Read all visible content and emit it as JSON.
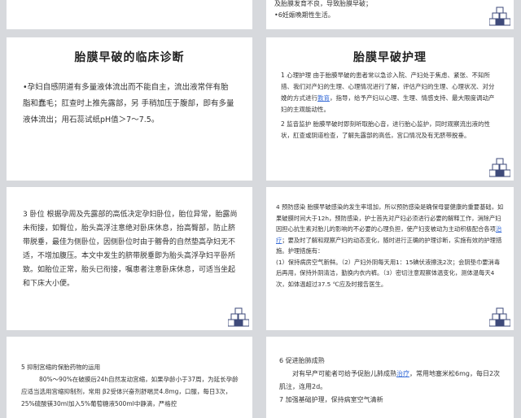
{
  "slides": {
    "s1": {
      "lines": [
        "及胎膜发育不良，导致胎膜早破；",
        "•6妊娠晚期性生活。"
      ]
    },
    "s2": {
      "title": "胎膜早破的临床诊断",
      "body": "•孕妇自感阴道有多量液体流出而不能自主，流出液常伴有胎脂和蠢毛；肛查时上推先露部，另 手稍加压于腹部，即有多量液体流出；用石蕊试纸pH值＞7～7.5。"
    },
    "s3": {
      "title": "胎膜早破护理",
      "p1": "1 心理护理 由于胎膜早破的患者常以急诊入院、产妇处于焦虑、紧张、不知所措、我们对产妇的生理、心理情况进行了解，评估产妇的生理、心理状况、对分娩的方式进行",
      "p1_link": "教育",
      "p1_rest": "，指导，给予产妇以心理、生理、情感支持、最大限度调动产妇的主观能动性。",
      "p2": "2 监音监护 胎膜早破时即刻听取胎心音，进行胎心监护，同时观察流出液的性状，肛查或阴道检查，了解先露部的高低，宫口情况及有无脐带脱垂。"
    },
    "s4": {
      "body": "3 卧位 根据孕周及先露部的高低决定孕妇卧位，胎位异常，胎露尚未衔接，如臀位，胎头高浮注意绝对卧床休息，抬高臀部，防止脐带脱垂，最佳为侧卧位，因侧卧位时由于髂骨的自然垫高孕妇无不适，不增加腹压。本文中发生的脐带脱垂即为胎头高浮孕妇平卧所致。如胎位正常，胎头已衔接，嘱患者注意卧床休息，可适当坐起和下床大小便。"
    },
    "s5": {
      "p1": "4 预防感染 胎膜早破感染的发生率增加，所以预防感染是确保母婴健康的重要基础，如果破膜时间大于12h，预防感染，护士首先对产妇必须进行必要的解释工作，消除产妇因担心抗生素对胎儿的影响的不必要的心理负担，使产妇变被动为主动积极配合各项",
      "p1_link": "治疗",
      "p1_rest": "；要及时了解和观察产妇的动态变化，随时进行正确的护理诊断，实施有效的护理措施。护理措施有：",
      "p2": "(1）保持病房空气新鲜。（2）产妇外阴每天用1：15碘伏液擦洗2次；会阴垫巾要消毒后再用，保持外阴清洁，勤换内衣内裤。（3）密切注意观察体温变化，测体温每天4次，如体温超过37.5 ℃应及时报告医生。"
    },
    "s6": {
      "p1": "5 抑制宫缩的保胎药物的运用",
      "p2": "80%～90%在破膜后24h自然发动宫缩，如果孕龄小于37周，为延长孕龄应适当选用宫缩抑制剂，常用 β2受体兴奋剂舒喘灵4.8mg，口服，每日3次，25%硫酸镁30ml加入5%葡萄糖液500ml中静滴，严格控"
    },
    "s7": {
      "p1": "6 促进胎肺成熟",
      "p2": "对有早产可能者可给予促胎儿肺成熟",
      "p2_link": "治疗",
      "p2_rest": "，常用地塞米松6mg，每日2次肌注，连用2d。",
      "p3": "7 加强基础护理，保持病室空气清新"
    }
  },
  "icon": "stacked-cubes-icon",
  "colors": {
    "link": "#3b6fd8",
    "background": "#d7d9dd",
    "cube": "#3e4a7a"
  }
}
